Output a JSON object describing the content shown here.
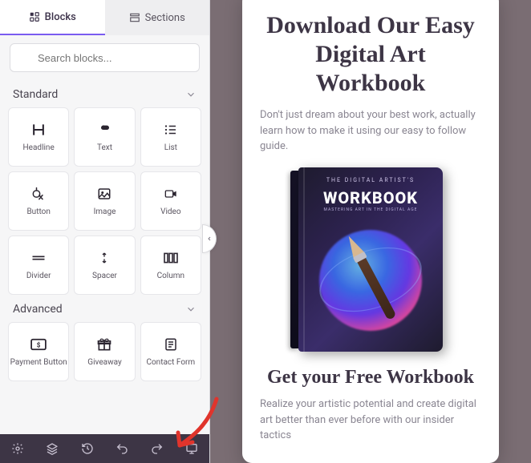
{
  "tabs": {
    "blocks": "Blocks",
    "sections": "Sections"
  },
  "search": {
    "placeholder": "Search blocks..."
  },
  "sections": {
    "standard": {
      "label": "Standard",
      "items": [
        {
          "label": "Headline"
        },
        {
          "label": "Text"
        },
        {
          "label": "List"
        },
        {
          "label": "Button"
        },
        {
          "label": "Image"
        },
        {
          "label": "Video"
        },
        {
          "label": "Divider"
        },
        {
          "label": "Spacer"
        },
        {
          "label": "Column"
        }
      ]
    },
    "advanced": {
      "label": "Advanced",
      "items": [
        {
          "label": "Payment Button"
        },
        {
          "label": "Giveaway"
        },
        {
          "label": "Contact Form"
        }
      ]
    }
  },
  "preview": {
    "title": "Download Our Easy Digital Art Workbook",
    "subtitle": "Don't just dream about your best work, actually learn how to make it using our easy to follow guide.",
    "book_supertitle": "THE DIGITAL ARTIST'S",
    "book_title": "WORKBOOK",
    "book_tag": "MASTERING ART IN THE DIGITAL AGE",
    "cta_title": "Get your Free Workbook",
    "cta_sub": "Realize your artistic potential and create digital art better than ever before with our insider tactics"
  }
}
